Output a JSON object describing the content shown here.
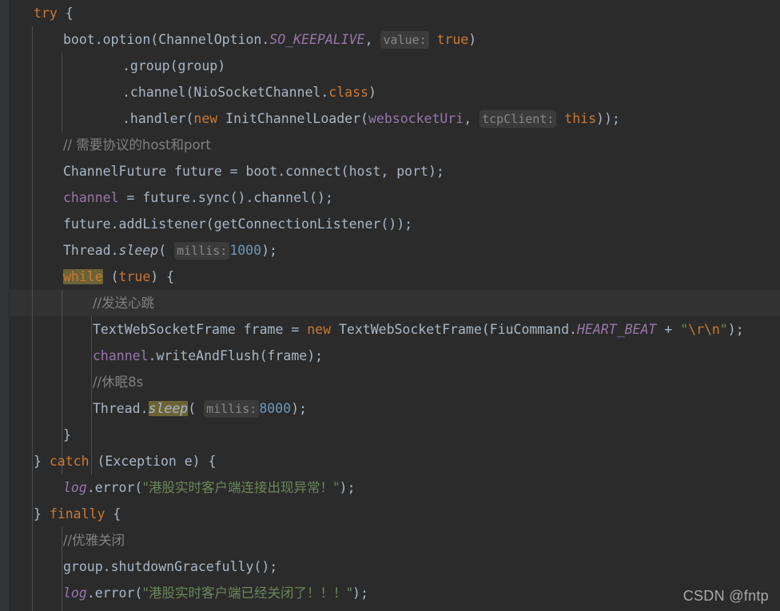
{
  "editor": {
    "theme": "darcula",
    "background": "#2b2b2b",
    "gutter_color": "#313335",
    "current_line_color": "#323232",
    "current_line_index": 11,
    "indent_guide_color": "#4b4f52",
    "language": "Java",
    "font_size_px": 16.5,
    "line_height_px": 33,
    "colors": {
      "keyword": "#cc7832",
      "identifier": "#a9b7c6",
      "field": "#9876aa",
      "static_member": "#9876aa",
      "number": "#6897bb",
      "string": "#6a8759",
      "escape": "#cc7832",
      "comment": "#808080",
      "hint_background": "#3b3b3b",
      "hint_text": "#868686",
      "occurrence_highlight": "#6b6336"
    }
  },
  "code_lines": [
    {
      "indent": 0,
      "text": "try {"
    },
    {
      "indent": 1,
      "text": "boot.option(ChannelOption.SO_KEEPALIVE,  value: true)"
    },
    {
      "indent": 3,
      "text": ".group(group)"
    },
    {
      "indent": 3,
      "text": ".channel(NioSocketChannel.class)"
    },
    {
      "indent": 3,
      "text": ".handler(new InitChannelLoader(websocketUri,  tcpClient: this));"
    },
    {
      "indent": 1,
      "text": "// 需要协议的host和port"
    },
    {
      "indent": 1,
      "text": "ChannelFuture future = boot.connect(host, port);"
    },
    {
      "indent": 1,
      "text": "channel = future.sync().channel();"
    },
    {
      "indent": 1,
      "text": "future.addListener(getConnectionListener());"
    },
    {
      "indent": 1,
      "text": "Thread.sleep( millis: 1000);"
    },
    {
      "indent": 1,
      "text": "while (true) {"
    },
    {
      "indent": 2,
      "text": "//发送心跳"
    },
    {
      "indent": 2,
      "text": "TextWebSocketFrame frame = new TextWebSocketFrame(FiuCommand.HEART_BEAT + \"\\r\\n\");"
    },
    {
      "indent": 2,
      "text": "channel.writeAndFlush(frame);"
    },
    {
      "indent": 2,
      "text": "//休眠8s"
    },
    {
      "indent": 2,
      "text": "Thread.sleep( millis: 8000);"
    },
    {
      "indent": 1,
      "text": "}"
    },
    {
      "indent": 0,
      "text": "} catch (Exception e) {"
    },
    {
      "indent": 1,
      "text": "log.error(\"港股实时客户端连接出现异常！\");"
    },
    {
      "indent": 0,
      "text": "} finally {"
    },
    {
      "indent": 1,
      "text": "//优雅关闭"
    },
    {
      "indent": 1,
      "text": "group.shutdownGracefully();"
    },
    {
      "indent": 1,
      "text": "log.error(\"港股实时客户端已经关闭了！！！\");"
    }
  ],
  "inline_hints": [
    {
      "label": "value:",
      "line": 1
    },
    {
      "label": "tcpClient:",
      "line": 4
    },
    {
      "label": "millis:",
      "line": 9
    },
    {
      "label": "millis:",
      "line": 15
    }
  ],
  "tokens": {
    "try": "try",
    "catch": "catch",
    "finally": "finally",
    "while": "while",
    "new": "new",
    "class": "class",
    "this": "this",
    "true": "true"
  },
  "literals": {
    "millis_1000": "1000",
    "millis_8000": "8000",
    "crlf_string": "\"\\r\\n\"",
    "error_msg_connect": "\"港股实时客户端连接出现异常！\"",
    "error_msg_closed": "\"港股实时客户端已经关闭了！！！\""
  },
  "comments": {
    "host_port": "// 需要协议的host和port",
    "heartbeat": "//发送心跳",
    "sleep8s": "//休眠8s",
    "graceful": "//优雅关闭"
  },
  "highlighted_occurrences": [
    {
      "text": "while",
      "line": 10
    },
    {
      "text": "sleep",
      "line": 15
    }
  ],
  "watermark": {
    "text": "CSDN @fntp"
  }
}
